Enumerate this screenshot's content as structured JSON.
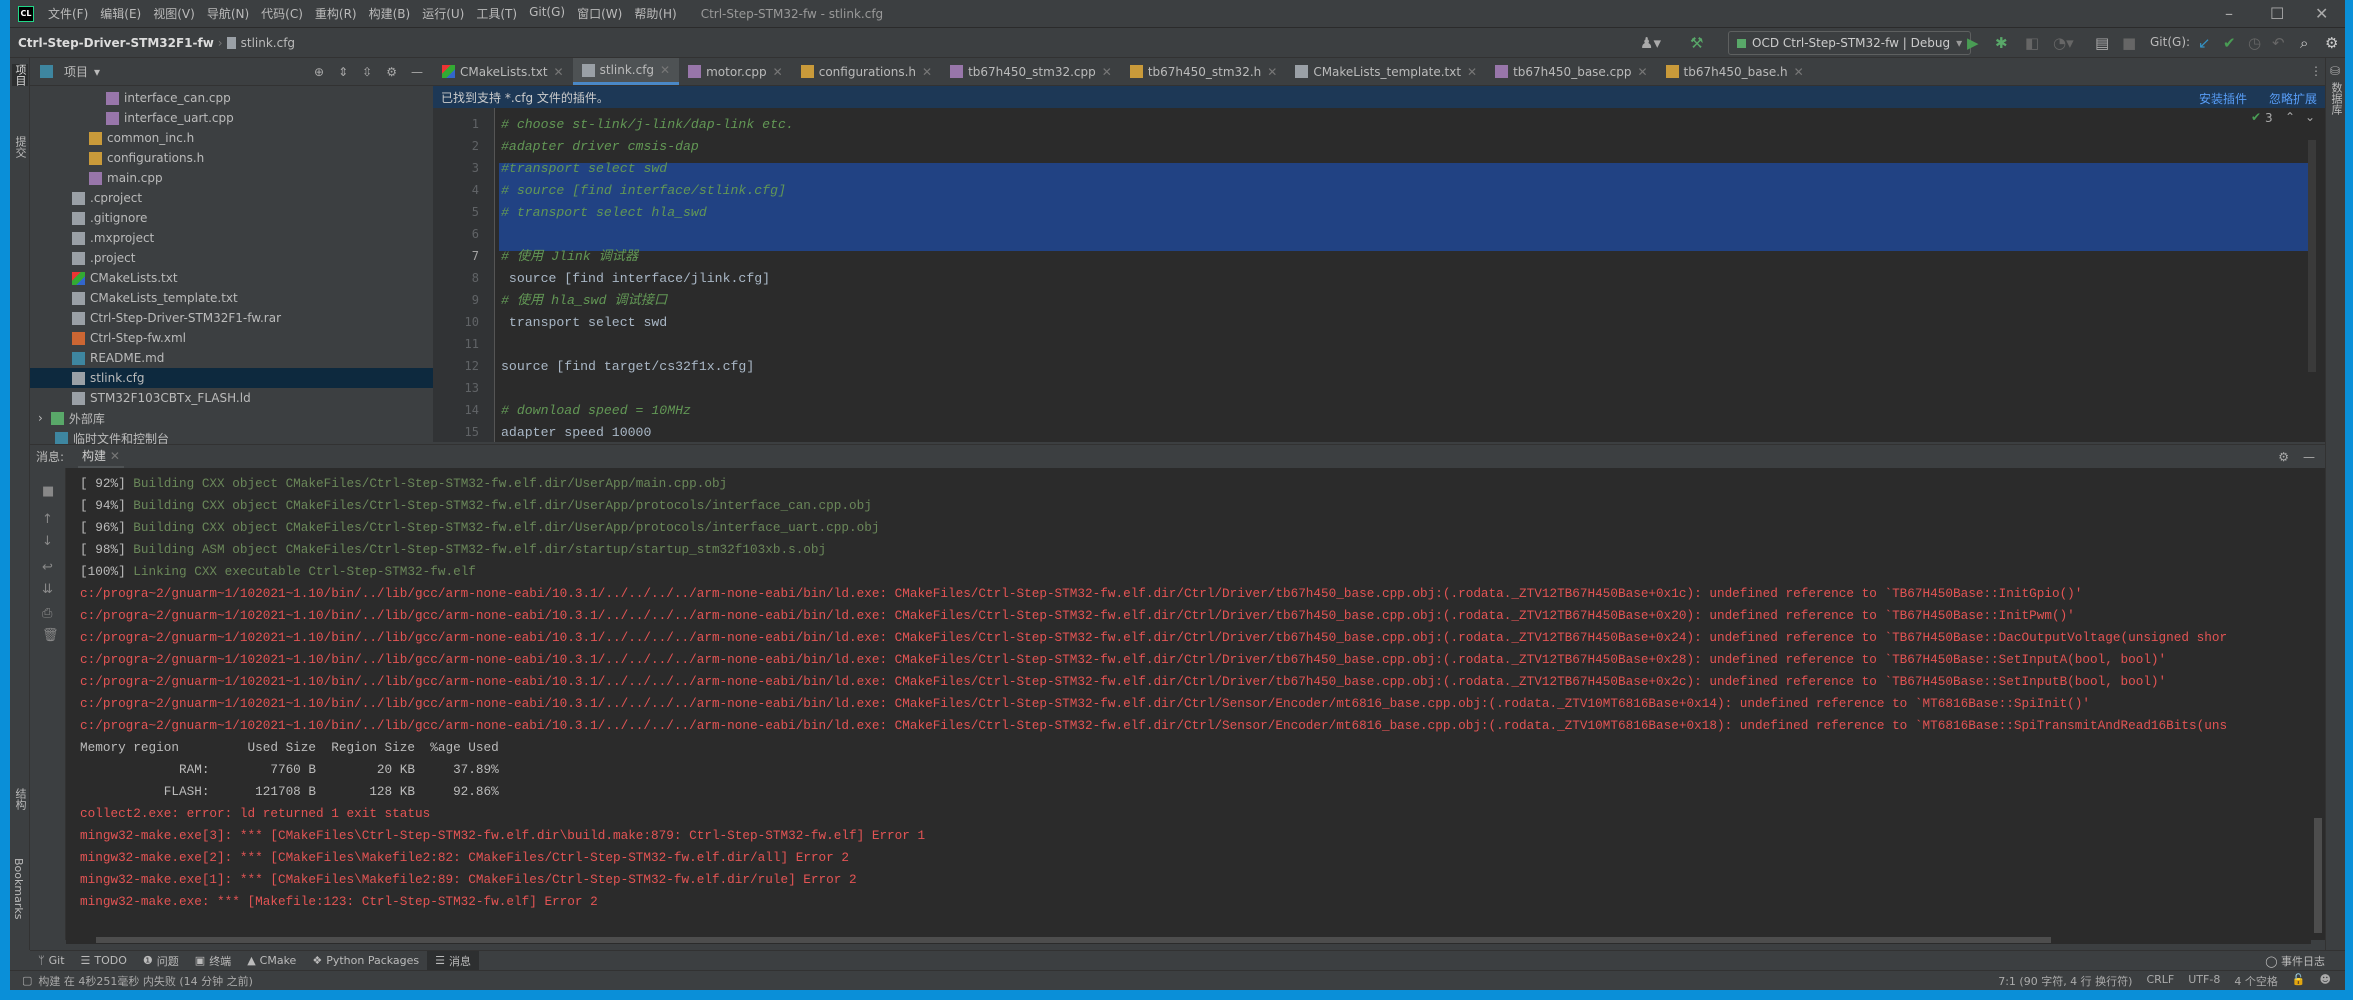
{
  "app": {
    "logo": "CL",
    "window_title": "Ctrl-Step-STM32-fw - stlink.cfg"
  },
  "menu": [
    "文件(F)",
    "编辑(E)",
    "视图(V)",
    "导航(N)",
    "代码(C)",
    "重构(R)",
    "构建(B)",
    "运行(U)",
    "工具(T)",
    "Git(G)",
    "窗口(W)",
    "帮助(H)"
  ],
  "breadcrumb": {
    "project": "Ctrl-Step-Driver-STM32F1-fw",
    "file": "stlink.cfg"
  },
  "toolbar": {
    "run_config": "OCD Ctrl-Step-STM32-fw | Debug",
    "git_label": "Git(G):"
  },
  "left_strip": [
    "项目",
    "提交",
    "结构",
    "Bookmarks"
  ],
  "right_strip": [
    "数据库"
  ],
  "project": {
    "title": "项目",
    "items": [
      {
        "label": "interface_can.cpp",
        "type": "cpp",
        "indent": 4
      },
      {
        "label": "interface_uart.cpp",
        "type": "cpp",
        "indent": 4
      },
      {
        "label": "common_inc.h",
        "type": "h",
        "indent": 3
      },
      {
        "label": "configurations.h",
        "type": "h",
        "indent": 3
      },
      {
        "label": "main.cpp",
        "type": "cpp",
        "indent": 3
      },
      {
        "label": ".cproject",
        "type": "txt",
        "indent": 2
      },
      {
        "label": ".gitignore",
        "type": "txt",
        "indent": 2
      },
      {
        "label": ".mxproject",
        "type": "txt",
        "indent": 2
      },
      {
        "label": ".project",
        "type": "txt",
        "indent": 2
      },
      {
        "label": "CMakeLists.txt",
        "type": "cmake",
        "indent": 2
      },
      {
        "label": "CMakeLists_template.txt",
        "type": "txt",
        "indent": 2
      },
      {
        "label": "Ctrl-Step-Driver-STM32F1-fw.rar",
        "type": "txt",
        "indent": 2
      },
      {
        "label": "Ctrl-Step-fw.xml",
        "type": "xml",
        "indent": 2
      },
      {
        "label": "README.md",
        "type": "md",
        "indent": 2
      },
      {
        "label": "stlink.cfg",
        "type": "txt",
        "indent": 2,
        "selected": true
      },
      {
        "label": "STM32F103CBTx_FLASH.ld",
        "type": "txt",
        "indent": 2
      },
      {
        "label": "外部库",
        "type": "lib",
        "indent": 0,
        "expandable": true
      },
      {
        "label": "临时文件和控制台",
        "type": "md",
        "indent": 1
      }
    ]
  },
  "tabs": [
    {
      "label": "CMakeLists.txt",
      "type": "cmake"
    },
    {
      "label": "stlink.cfg",
      "type": "txt",
      "active": true
    },
    {
      "label": "motor.cpp",
      "type": "cpp"
    },
    {
      "label": "configurations.h",
      "type": "h"
    },
    {
      "label": "tb67h450_stm32.cpp",
      "type": "cpp"
    },
    {
      "label": "tb67h450_stm32.h",
      "type": "h"
    },
    {
      "label": "CMakeLists_template.txt",
      "type": "txt"
    },
    {
      "label": "tb67h450_base.cpp",
      "type": "cpp"
    },
    {
      "label": "tb67h450_base.h",
      "type": "h"
    }
  ],
  "notification": {
    "text": "已找到支持 *.cfg 文件的插件。",
    "install": "安装插件",
    "ignore": "忽略扩展"
  },
  "editor": {
    "inspection_count": "3",
    "lines": [
      {
        "n": "1",
        "text": "# choose st-link/j-link/dap-link etc.",
        "kind": "cmt"
      },
      {
        "n": "2",
        "text": "#adapter driver cmsis-dap",
        "kind": "cmt"
      },
      {
        "n": "3",
        "text": "#transport select swd",
        "kind": "cmt"
      },
      {
        "n": "4",
        "text": "# source [find interface/stlink.cfg]",
        "kind": "cmt"
      },
      {
        "n": "5",
        "text": "# transport select hla_swd",
        "kind": "cmt"
      },
      {
        "n": "6",
        "text": "",
        "kind": "plain"
      },
      {
        "n": "7",
        "text": "# 使用 Jlink 调试器",
        "kind": "cmt"
      },
      {
        "n": "8",
        "text": " source [find interface/jlink.cfg]",
        "kind": "plain"
      },
      {
        "n": "9",
        "text": "# 使用 hla_swd 调试接口",
        "kind": "cmt"
      },
      {
        "n": "10",
        "text": " transport select swd",
        "kind": "plain"
      },
      {
        "n": "11",
        "text": "",
        "kind": "plain"
      },
      {
        "n": "12",
        "text": "source [find target/cs32f1x.cfg]",
        "kind": "plain"
      },
      {
        "n": "13",
        "text": "",
        "kind": "plain"
      },
      {
        "n": "14",
        "text": "# download speed = 10MHz",
        "kind": "cmt"
      },
      {
        "n": "15",
        "text": "adapter speed 10000",
        "kind": "plain"
      }
    ]
  },
  "build": {
    "label": "消息:",
    "tab": "构建",
    "lines": [
      {
        "prefix": "[ 92%] ",
        "text": "Building CXX object CMakeFiles/Ctrl-Step-STM32-fw.elf.dir/UserApp/main.cpp.obj",
        "kind": "green"
      },
      {
        "prefix": "[ 94%] ",
        "text": "Building CXX object CMakeFiles/Ctrl-Step-STM32-fw.elf.dir/UserApp/protocols/interface_can.cpp.obj",
        "kind": "green"
      },
      {
        "prefix": "[ 96%] ",
        "text": "Building CXX object CMakeFiles/Ctrl-Step-STM32-fw.elf.dir/UserApp/protocols/interface_uart.cpp.obj",
        "kind": "green"
      },
      {
        "prefix": "[ 98%] ",
        "text": "Building ASM object CMakeFiles/Ctrl-Step-STM32-fw.elf.dir/startup/startup_stm32f103xb.s.obj",
        "kind": "green"
      },
      {
        "prefix": "[100%] ",
        "text": "Linking CXX executable Ctrl-Step-STM32-fw.elf",
        "kind": "green"
      },
      {
        "prefix": "",
        "text": "c:/progra~2/gnuarm~1/102021~1.10/bin/../lib/gcc/arm-none-eabi/10.3.1/../../../../arm-none-eabi/bin/ld.exe: CMakeFiles/Ctrl-Step-STM32-fw.elf.dir/Ctrl/Driver/tb67h450_base.cpp.obj:(.rodata._ZTV12TB67H450Base+0x1c): undefined reference to `TB67H450Base::InitGpio()'",
        "kind": "red"
      },
      {
        "prefix": "",
        "text": "c:/progra~2/gnuarm~1/102021~1.10/bin/../lib/gcc/arm-none-eabi/10.3.1/../../../../arm-none-eabi/bin/ld.exe: CMakeFiles/Ctrl-Step-STM32-fw.elf.dir/Ctrl/Driver/tb67h450_base.cpp.obj:(.rodata._ZTV12TB67H450Base+0x20): undefined reference to `TB67H450Base::InitPwm()'",
        "kind": "red"
      },
      {
        "prefix": "",
        "text": "c:/progra~2/gnuarm~1/102021~1.10/bin/../lib/gcc/arm-none-eabi/10.3.1/../../../../arm-none-eabi/bin/ld.exe: CMakeFiles/Ctrl-Step-STM32-fw.elf.dir/Ctrl/Driver/tb67h450_base.cpp.obj:(.rodata._ZTV12TB67H450Base+0x24): undefined reference to `TB67H450Base::DacOutputVoltage(unsigned shor",
        "kind": "red"
      },
      {
        "prefix": "",
        "text": "c:/progra~2/gnuarm~1/102021~1.10/bin/../lib/gcc/arm-none-eabi/10.3.1/../../../../arm-none-eabi/bin/ld.exe: CMakeFiles/Ctrl-Step-STM32-fw.elf.dir/Ctrl/Driver/tb67h450_base.cpp.obj:(.rodata._ZTV12TB67H450Base+0x28): undefined reference to `TB67H450Base::SetInputA(bool, bool)'",
        "kind": "red"
      },
      {
        "prefix": "",
        "text": "c:/progra~2/gnuarm~1/102021~1.10/bin/../lib/gcc/arm-none-eabi/10.3.1/../../../../arm-none-eabi/bin/ld.exe: CMakeFiles/Ctrl-Step-STM32-fw.elf.dir/Ctrl/Driver/tb67h450_base.cpp.obj:(.rodata._ZTV12TB67H450Base+0x2c): undefined reference to `TB67H450Base::SetInputB(bool, bool)'",
        "kind": "red"
      },
      {
        "prefix": "",
        "text": "c:/progra~2/gnuarm~1/102021~1.10/bin/../lib/gcc/arm-none-eabi/10.3.1/../../../../arm-none-eabi/bin/ld.exe: CMakeFiles/Ctrl-Step-STM32-fw.elf.dir/Ctrl/Sensor/Encoder/mt6816_base.cpp.obj:(.rodata._ZTV10MT6816Base+0x14): undefined reference to `MT6816Base::SpiInit()'",
        "kind": "red"
      },
      {
        "prefix": "",
        "text": "c:/progra~2/gnuarm~1/102021~1.10/bin/../lib/gcc/arm-none-eabi/10.3.1/../../../../arm-none-eabi/bin/ld.exe: CMakeFiles/Ctrl-Step-STM32-fw.elf.dir/Ctrl/Sensor/Encoder/mt6816_base.cpp.obj:(.rodata._ZTV10MT6816Base+0x18): undefined reference to `MT6816Base::SpiTransmitAndRead16Bits(uns",
        "kind": "red"
      },
      {
        "prefix": "",
        "text": "Memory region         Used Size  Region Size  %age Used",
        "kind": "plain"
      },
      {
        "prefix": "",
        "text": "             RAM:        7760 B        20 KB     37.89%",
        "kind": "plain"
      },
      {
        "prefix": "",
        "text": "           FLASH:      121708 B       128 KB     92.86%",
        "kind": "plain"
      },
      {
        "prefix": "",
        "text": "collect2.exe: error: ld returned 1 exit status",
        "kind": "red"
      },
      {
        "prefix": "",
        "text": "mingw32-make.exe[3]: *** [CMakeFiles\\Ctrl-Step-STM32-fw.elf.dir\\build.make:879: Ctrl-Step-STM32-fw.elf] Error 1",
        "kind": "red"
      },
      {
        "prefix": "",
        "text": "mingw32-make.exe[2]: *** [CMakeFiles\\Makefile2:82: CMakeFiles/Ctrl-Step-STM32-fw.elf.dir/all] Error 2",
        "kind": "red"
      },
      {
        "prefix": "",
        "text": "mingw32-make.exe[1]: *** [CMakeFiles\\Makefile2:89: CMakeFiles/Ctrl-Step-STM32-fw.elf.dir/rule] Error 2",
        "kind": "red"
      },
      {
        "prefix": "",
        "text": "mingw32-make.exe: *** [Makefile:123: Ctrl-Step-STM32-fw.elf] Error 2",
        "kind": "red"
      }
    ]
  },
  "tool_windows": [
    {
      "label": "Git",
      "icon": "branch-icon"
    },
    {
      "label": "TODO",
      "icon": "list-icon"
    },
    {
      "label": "问题",
      "icon": "alert-icon"
    },
    {
      "label": "终端",
      "icon": "terminal-icon"
    },
    {
      "label": "CMake",
      "icon": "cmake-icon"
    },
    {
      "label": "Python Packages",
      "icon": "package-icon"
    },
    {
      "label": "消息",
      "icon": "messages-icon",
      "active": true
    }
  ],
  "event_log": "事件日志",
  "status": {
    "message": "构建 在 4秒251毫秒 内失败 (14 分钟 之前)",
    "position": "7:1 (90 字符, 4 行 换行符)",
    "line_ending": "CRLF",
    "encoding": "UTF-8",
    "indent": "4 个空格"
  },
  "colors": {
    "accent": "#4a88c7",
    "error": "#e35454",
    "success": "#6a8759",
    "selection": "#214283",
    "comment": "#629755"
  }
}
